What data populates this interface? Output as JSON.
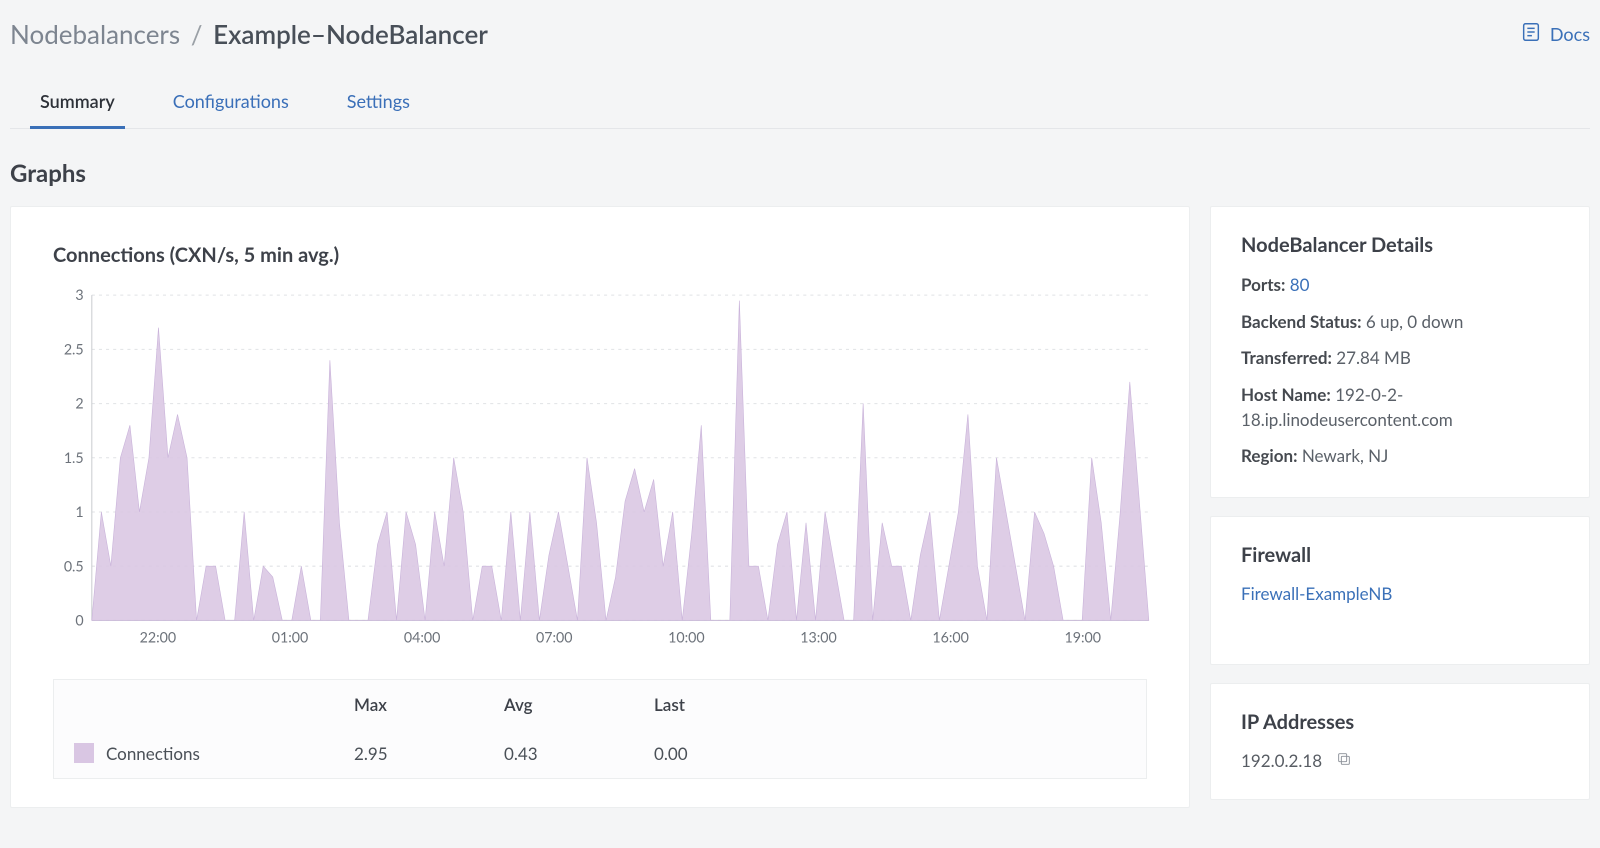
{
  "header": {
    "breadcrumb_root": "Nodebalancers",
    "breadcrumb_sep": "/",
    "breadcrumb_current": "Example–NodeBalancer",
    "docs_label": "Docs"
  },
  "tabs": {
    "summary": "Summary",
    "configurations": "Configurations",
    "settings": "Settings"
  },
  "graphs_heading": "Graphs",
  "chart": {
    "title": "Connections (CXN/s, 5 min avg.)",
    "legend_series_label": "Connections",
    "legend_cols": {
      "max": "Max",
      "avg": "Avg",
      "last": "Last"
    },
    "legend_vals": {
      "max": "2.95",
      "avg": "0.43",
      "last": "0.00"
    }
  },
  "chart_data": {
    "type": "area",
    "title": "Connections (CXN/s, 5 min avg.)",
    "xlabel": "",
    "ylabel": "",
    "ylim": [
      0,
      3
    ],
    "y_ticks": [
      0,
      0.5,
      1,
      1.5,
      2,
      2.5,
      3
    ],
    "x_tick_labels": [
      "22:00",
      "01:00",
      "04:00",
      "07:00",
      "10:00",
      "13:00",
      "16:00",
      "19:00"
    ],
    "series": [
      {
        "name": "Connections",
        "color": "#d9c6e3",
        "values": [
          0.0,
          1.0,
          0.5,
          1.5,
          1.8,
          1.0,
          1.5,
          2.7,
          1.5,
          1.9,
          1.5,
          0.0,
          0.5,
          0.5,
          0.0,
          0.0,
          1.0,
          0.0,
          0.5,
          0.4,
          0.0,
          0.0,
          0.5,
          0.0,
          0.0,
          2.4,
          0.9,
          0.0,
          0.0,
          0.0,
          0.7,
          1.0,
          0.0,
          1.0,
          0.7,
          0.0,
          1.0,
          0.5,
          1.5,
          1.0,
          0.0,
          0.5,
          0.5,
          0.0,
          1.0,
          0.0,
          1.0,
          0.0,
          0.6,
          1.0,
          0.5,
          0.0,
          1.5,
          0.9,
          0.0,
          0.4,
          1.1,
          1.4,
          1.0,
          1.3,
          0.5,
          1.0,
          0.0,
          0.8,
          1.8,
          0.0,
          0.0,
          0.0,
          2.95,
          0.5,
          0.5,
          0.0,
          0.7,
          1.0,
          0.0,
          0.9,
          0.0,
          1.0,
          0.5,
          0.0,
          0.0,
          2.0,
          0.0,
          0.9,
          0.5,
          0.5,
          0.0,
          0.6,
          1.0,
          0.0,
          0.5,
          1.0,
          1.9,
          0.5,
          0.0,
          1.5,
          1.0,
          0.5,
          0.0,
          1.0,
          0.8,
          0.5,
          0.0,
          0.0,
          0.0,
          1.5,
          0.9,
          0.0,
          1.0,
          2.2,
          1.1,
          0.0
        ]
      }
    ],
    "stats": {
      "max": 2.95,
      "avg": 0.43,
      "last": 0.0
    }
  },
  "details": {
    "card_title": "NodeBalancer Details",
    "ports_label": "Ports:",
    "ports_value": "80",
    "backend_label": "Backend Status:",
    "backend_value": "6 up, 0 down",
    "transferred_label": "Transferred:",
    "transferred_value": "27.84 MB",
    "hostname_label": "Host Name:",
    "hostname_value": "192-0-2-18.ip.linodeusercontent.com",
    "region_label": "Region:",
    "region_value": "Newark, NJ"
  },
  "firewall": {
    "card_title": "Firewall",
    "link_label": "Firewall-ExampleNB"
  },
  "ip": {
    "card_title": "IP Addresses",
    "address": "192.0.2.18"
  }
}
